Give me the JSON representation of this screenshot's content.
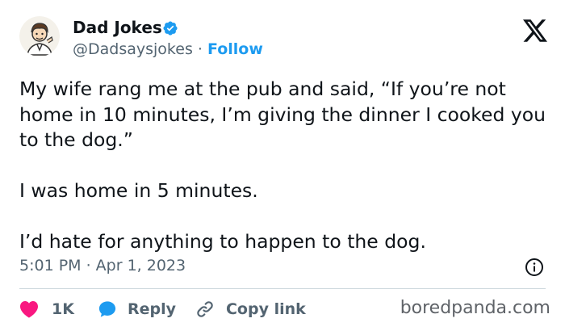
{
  "author": {
    "name": "Dad Jokes",
    "handle": "@Dadsaysjokes",
    "separator": "·",
    "follow_label": "Follow",
    "verified_icon": "verified-badge-icon",
    "avatar_icon": "dad-cartoon-avatar"
  },
  "tweet": {
    "paragraphs": [
      "My wife rang me at the pub and said, “If you’re not home in 10 minutes, I’m giving the dinner I cooked you to the dog.”",
      "I was home in 5 minutes.",
      "I’d hate for anything to happen to the dog."
    ],
    "timestamp": "5:01 PM · Apr 1, 2023"
  },
  "actions": {
    "like_count": "1K",
    "reply_label": "Reply",
    "copy_link_label": "Copy link"
  },
  "watermark": "boredpanda.com",
  "colors": {
    "accent": "#1d9bf0",
    "like": "#f91880",
    "text": "#0f1419",
    "secondary": "#536471"
  }
}
